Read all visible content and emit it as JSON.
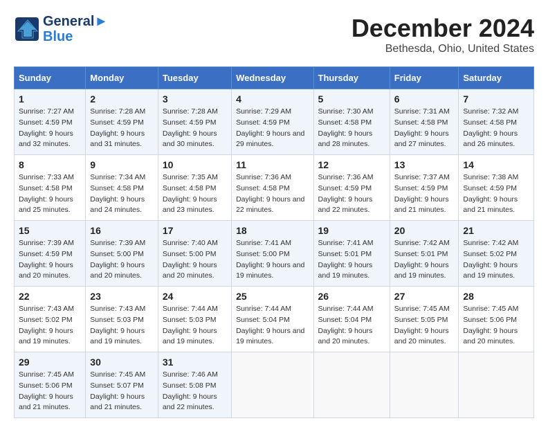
{
  "header": {
    "logo_line1": "General",
    "logo_line2": "Blue",
    "month": "December 2024",
    "location": "Bethesda, Ohio, United States"
  },
  "days_of_week": [
    "Sunday",
    "Monday",
    "Tuesday",
    "Wednesday",
    "Thursday",
    "Friday",
    "Saturday"
  ],
  "weeks": [
    [
      {
        "day": "1",
        "sunrise": "7:27 AM",
        "sunset": "4:59 PM",
        "daylight": "9 hours and 32 minutes."
      },
      {
        "day": "2",
        "sunrise": "7:28 AM",
        "sunset": "4:59 PM",
        "daylight": "9 hours and 31 minutes."
      },
      {
        "day": "3",
        "sunrise": "7:28 AM",
        "sunset": "4:59 PM",
        "daylight": "9 hours and 30 minutes."
      },
      {
        "day": "4",
        "sunrise": "7:29 AM",
        "sunset": "4:59 PM",
        "daylight": "9 hours and 29 minutes."
      },
      {
        "day": "5",
        "sunrise": "7:30 AM",
        "sunset": "4:58 PM",
        "daylight": "9 hours and 28 minutes."
      },
      {
        "day": "6",
        "sunrise": "7:31 AM",
        "sunset": "4:58 PM",
        "daylight": "9 hours and 27 minutes."
      },
      {
        "day": "7",
        "sunrise": "7:32 AM",
        "sunset": "4:58 PM",
        "daylight": "9 hours and 26 minutes."
      }
    ],
    [
      {
        "day": "8",
        "sunrise": "7:33 AM",
        "sunset": "4:58 PM",
        "daylight": "9 hours and 25 minutes."
      },
      {
        "day": "9",
        "sunrise": "7:34 AM",
        "sunset": "4:58 PM",
        "daylight": "9 hours and 24 minutes."
      },
      {
        "day": "10",
        "sunrise": "7:35 AM",
        "sunset": "4:58 PM",
        "daylight": "9 hours and 23 minutes."
      },
      {
        "day": "11",
        "sunrise": "7:36 AM",
        "sunset": "4:58 PM",
        "daylight": "9 hours and 22 minutes."
      },
      {
        "day": "12",
        "sunrise": "7:36 AM",
        "sunset": "4:59 PM",
        "daylight": "9 hours and 22 minutes."
      },
      {
        "day": "13",
        "sunrise": "7:37 AM",
        "sunset": "4:59 PM",
        "daylight": "9 hours and 21 minutes."
      },
      {
        "day": "14",
        "sunrise": "7:38 AM",
        "sunset": "4:59 PM",
        "daylight": "9 hours and 21 minutes."
      }
    ],
    [
      {
        "day": "15",
        "sunrise": "7:39 AM",
        "sunset": "4:59 PM",
        "daylight": "9 hours and 20 minutes."
      },
      {
        "day": "16",
        "sunrise": "7:39 AM",
        "sunset": "5:00 PM",
        "daylight": "9 hours and 20 minutes."
      },
      {
        "day": "17",
        "sunrise": "7:40 AM",
        "sunset": "5:00 PM",
        "daylight": "9 hours and 20 minutes."
      },
      {
        "day": "18",
        "sunrise": "7:41 AM",
        "sunset": "5:00 PM",
        "daylight": "9 hours and 19 minutes."
      },
      {
        "day": "19",
        "sunrise": "7:41 AM",
        "sunset": "5:01 PM",
        "daylight": "9 hours and 19 minutes."
      },
      {
        "day": "20",
        "sunrise": "7:42 AM",
        "sunset": "5:01 PM",
        "daylight": "9 hours and 19 minutes."
      },
      {
        "day": "21",
        "sunrise": "7:42 AM",
        "sunset": "5:02 PM",
        "daylight": "9 hours and 19 minutes."
      }
    ],
    [
      {
        "day": "22",
        "sunrise": "7:43 AM",
        "sunset": "5:02 PM",
        "daylight": "9 hours and 19 minutes."
      },
      {
        "day": "23",
        "sunrise": "7:43 AM",
        "sunset": "5:03 PM",
        "daylight": "9 hours and 19 minutes."
      },
      {
        "day": "24",
        "sunrise": "7:44 AM",
        "sunset": "5:03 PM",
        "daylight": "9 hours and 19 minutes."
      },
      {
        "day": "25",
        "sunrise": "7:44 AM",
        "sunset": "5:04 PM",
        "daylight": "9 hours and 19 minutes."
      },
      {
        "day": "26",
        "sunrise": "7:44 AM",
        "sunset": "5:04 PM",
        "daylight": "9 hours and 20 minutes."
      },
      {
        "day": "27",
        "sunrise": "7:45 AM",
        "sunset": "5:05 PM",
        "daylight": "9 hours and 20 minutes."
      },
      {
        "day": "28",
        "sunrise": "7:45 AM",
        "sunset": "5:06 PM",
        "daylight": "9 hours and 20 minutes."
      }
    ],
    [
      {
        "day": "29",
        "sunrise": "7:45 AM",
        "sunset": "5:06 PM",
        "daylight": "9 hours and 21 minutes."
      },
      {
        "day": "30",
        "sunrise": "7:45 AM",
        "sunset": "5:07 PM",
        "daylight": "9 hours and 21 minutes."
      },
      {
        "day": "31",
        "sunrise": "7:46 AM",
        "sunset": "5:08 PM",
        "daylight": "9 hours and 22 minutes."
      },
      null,
      null,
      null,
      null
    ]
  ],
  "labels": {
    "sunrise": "Sunrise:",
    "sunset": "Sunset:",
    "daylight": "Daylight:"
  }
}
